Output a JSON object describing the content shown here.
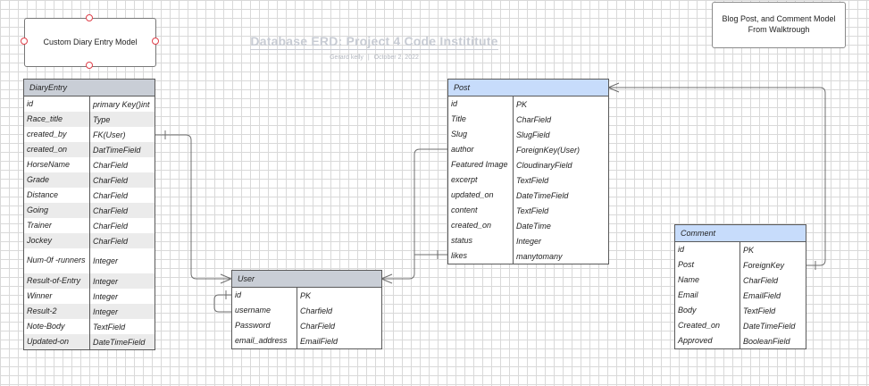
{
  "document": {
    "title": "Database ERD: Project 4 Code Instititute",
    "author": "Gerard kelly",
    "date": "October 2, 2022"
  },
  "notes": {
    "custom_model": "Custom Diary Entry Model",
    "walkthrough": "Blog Post, and Comment Model From Walktrough"
  },
  "entities": {
    "diary": {
      "name": "DiaryEntry",
      "rows": [
        [
          "id",
          "primary Key()int"
        ],
        [
          "Race_title",
          "Type"
        ],
        [
          "created_by",
          "FK(User)"
        ],
        [
          "created_on",
          "DatTimeField"
        ],
        [
          "HorseName",
          "CharField"
        ],
        [
          "Grade",
          "CharField"
        ],
        [
          "Distance",
          "CharField"
        ],
        [
          "Going",
          "CharField"
        ],
        [
          "Trainer",
          "CharField"
        ],
        [
          "Jockey",
          "CharField"
        ],
        [
          "Num-0f -runners",
          "Integer"
        ],
        [
          "Result-of-Entry",
          "Integer"
        ],
        [
          "Winner",
          "Integer"
        ],
        [
          "Result-2",
          "Integer"
        ],
        [
          "Note-Body",
          "TextField"
        ],
        [
          "Updated-on",
          "DateTimeField"
        ]
      ]
    },
    "user": {
      "name": "User",
      "rows": [
        [
          "id",
          "PK"
        ],
        [
          "username",
          "Charfield"
        ],
        [
          "Password",
          "CharField"
        ],
        [
          "email_address",
          "EmailField"
        ]
      ]
    },
    "post": {
      "name": "Post",
      "rows": [
        [
          "id",
          "PK"
        ],
        [
          "Title",
          "CharField"
        ],
        [
          "Slug",
          "SlugField"
        ],
        [
          "author",
          "ForeignKey(User)"
        ],
        [
          "Featured Image",
          "CloudinaryField"
        ],
        [
          "excerpt",
          "TextField"
        ],
        [
          "updated_on",
          "DateTimeField"
        ],
        [
          "content",
          "TextField"
        ],
        [
          "created_on",
          "DateTime"
        ],
        [
          "status",
          "Integer"
        ],
        [
          "likes",
          "manytomany"
        ]
      ]
    },
    "comment": {
      "name": "Comment",
      "rows": [
        [
          "id",
          "PK"
        ],
        [
          "Post",
          "ForeignKey"
        ],
        [
          "Name",
          "CharField"
        ],
        [
          "Email",
          "EmailField"
        ],
        [
          "Body",
          "TextField"
        ],
        [
          "Created_on",
          "DateTimeField"
        ],
        [
          "Approved",
          "BooleanField"
        ]
      ]
    }
  }
}
